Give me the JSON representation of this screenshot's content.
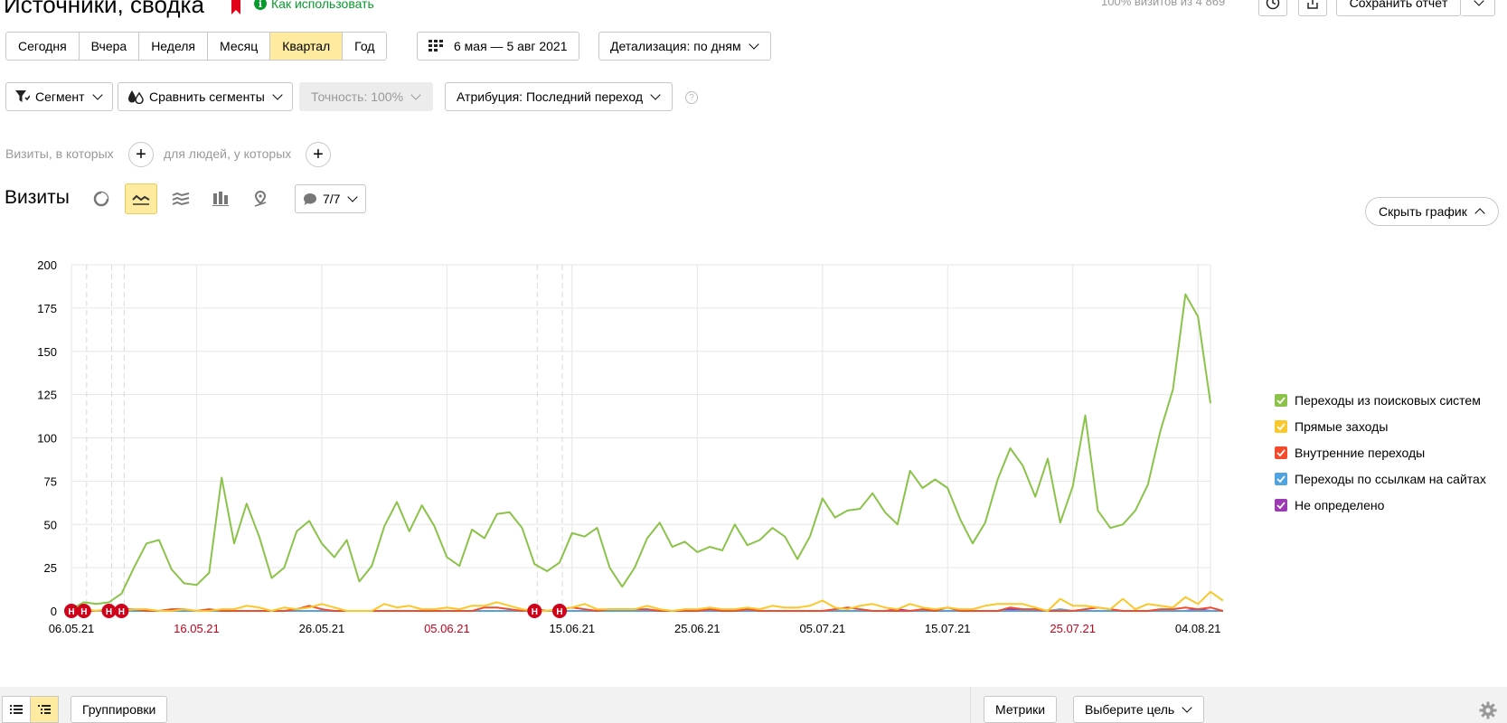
{
  "header": {
    "title": "Источники, сводка",
    "howto_label": "Как использовать",
    "visits_stat": "100% визитов из 4 869",
    "save_label": "Сохранить отчёт"
  },
  "period": {
    "buttons": [
      "Сегодня",
      "Вчера",
      "Неделя",
      "Месяц",
      "Квартал",
      "Год"
    ],
    "active": "Квартал",
    "date_range": "6 мая — 5 авг 2021",
    "detail": "Детализация: по дням"
  },
  "toolbar": {
    "segment": "Сегмент",
    "compare": "Сравнить сегменты",
    "accuracy": "Точность: 100%",
    "attribution": "Атрибуция: Последний переход"
  },
  "filters": {
    "visits_where": "Визиты, в которых",
    "people_where": "для людей, у которых"
  },
  "chart_header": {
    "label": "Визиты",
    "annotations": "7/7",
    "hide_chart": "Скрыть график"
  },
  "bottom": {
    "groupings": "Группировки",
    "metrics": "Метрики",
    "goal": "Выберите цель"
  },
  "chart_data": {
    "type": "line",
    "x_ticks": [
      "06.05.21",
      "16.05.21",
      "26.05.21",
      "05.06.21",
      "15.06.21",
      "25.06.21",
      "05.07.21",
      "15.07.21",
      "25.07.21",
      "04.08.21"
    ],
    "weekend_ticks": [
      "16.05.21",
      "05.06.21",
      "25.07.21"
    ],
    "y_ticks": [
      0,
      25,
      50,
      75,
      100,
      125,
      150,
      175,
      200
    ],
    "ylim": [
      0,
      200
    ],
    "x_range_days": 91,
    "holiday_marker_days": [
      0,
      1,
      3,
      4,
      37,
      39
    ],
    "holiday_marker_label": "Н",
    "grid": true,
    "legend_position": "right",
    "series": [
      {
        "name": "Переходы из поисковых систем",
        "color": "#8bc34a",
        "values": [
          1,
          5,
          4,
          5,
          10,
          25,
          39,
          41,
          24,
          16,
          15,
          22,
          77,
          39,
          62,
          43,
          19,
          25,
          46,
          52,
          39,
          31,
          41,
          17,
          26,
          49,
          63,
          46,
          61,
          49,
          31,
          26,
          47,
          42,
          56,
          57,
          48,
          27,
          23,
          28,
          45,
          43,
          48,
          25,
          14,
          25,
          42,
          51,
          37,
          40,
          34,
          37,
          35,
          50,
          38,
          41,
          48,
          43,
          30,
          43,
          65,
          54,
          58,
          59,
          68,
          57,
          50,
          81,
          71,
          76,
          71,
          53,
          39,
          51,
          76,
          94,
          84,
          66,
          88,
          51,
          72,
          113,
          58,
          48,
          50,
          58,
          73,
          104,
          128,
          183,
          170,
          120
        ]
      },
      {
        "name": "Прямые заходы",
        "color": "#f9c82b",
        "values": [
          0,
          1,
          0,
          1,
          0,
          1,
          1,
          0,
          0,
          1,
          0,
          0,
          1,
          1,
          3,
          2,
          0,
          2,
          1,
          2,
          4,
          2,
          0,
          0,
          0,
          4,
          2,
          3,
          1,
          1,
          2,
          1,
          3,
          3,
          5,
          3,
          1,
          0,
          0,
          1,
          2,
          4,
          1,
          1,
          1,
          1,
          3,
          1,
          0,
          1,
          1,
          2,
          1,
          1,
          2,
          1,
          3,
          2,
          2,
          3,
          6,
          2,
          1,
          3,
          4,
          2,
          1,
          4,
          2,
          1,
          2,
          1,
          1,
          3,
          4,
          4,
          4,
          2,
          0,
          7,
          3,
          3,
          2,
          1,
          7,
          1,
          4,
          3,
          2,
          8,
          4,
          11,
          6
        ]
      },
      {
        "name": "Внутренние переходы",
        "color": "#f54b2a",
        "values": [
          0,
          0,
          0,
          1,
          1,
          1,
          0,
          0,
          1,
          1,
          0,
          1,
          0,
          0,
          0,
          0,
          0,
          0,
          1,
          3,
          1,
          0,
          0,
          0,
          0,
          0,
          0,
          0,
          0,
          0,
          0,
          0,
          0,
          2,
          2,
          1,
          0,
          1,
          0,
          1,
          2,
          1,
          0,
          1,
          1,
          1,
          1,
          0,
          0,
          0,
          0,
          1,
          0,
          0,
          1,
          0,
          0,
          0,
          0,
          0,
          0,
          1,
          2,
          1,
          0,
          0,
          0,
          0,
          1,
          0,
          2,
          0,
          0,
          0,
          0,
          2,
          1,
          1,
          0,
          0,
          0,
          1,
          2,
          1,
          0,
          0,
          0,
          1,
          1,
          2,
          1,
          2,
          0
        ]
      },
      {
        "name": "Переходы по ссылкам на сайтах",
        "color": "#4fa3e0",
        "values": [
          0,
          0,
          0,
          0,
          0,
          0,
          0,
          0,
          0,
          0,
          0,
          0,
          0,
          0,
          0,
          0,
          0,
          0,
          0,
          0,
          0,
          0,
          0,
          0,
          0,
          0,
          0,
          0,
          0,
          0,
          0,
          0,
          0,
          0,
          0,
          0,
          0,
          0,
          0,
          0,
          0,
          0,
          0,
          0,
          0,
          0,
          0,
          0,
          0,
          0,
          0,
          0,
          0,
          0,
          0,
          0,
          0,
          0,
          0,
          0,
          0,
          0,
          0,
          0,
          0,
          0,
          0,
          0,
          0,
          0,
          0,
          0,
          0,
          0,
          0,
          0,
          0,
          0,
          0,
          1,
          0,
          0,
          0,
          0,
          0,
          0,
          0,
          0,
          0,
          0,
          0,
          0,
          0
        ]
      },
      {
        "name": "Не определено",
        "color": "#9c3ab3",
        "values": [
          0,
          0,
          0,
          0,
          0,
          0,
          0,
          0,
          0,
          0,
          0,
          0,
          0,
          0,
          0,
          0,
          0,
          0,
          0,
          0,
          0,
          0,
          0,
          0,
          0,
          0,
          0,
          0,
          0,
          0,
          0,
          0,
          0,
          0,
          0,
          0,
          0,
          0,
          0,
          0,
          0,
          0,
          0,
          0,
          0,
          0,
          0,
          0,
          0,
          0,
          0,
          0,
          0,
          0,
          0,
          0,
          0,
          0,
          0,
          0,
          0,
          0,
          0,
          0,
          0,
          0,
          1,
          0,
          0,
          0,
          0,
          0,
          0,
          0,
          0,
          1,
          0,
          0,
          0,
          0,
          0,
          0,
          0,
          0,
          0,
          0,
          0,
          0,
          0,
          0,
          1,
          0,
          0
        ]
      }
    ]
  }
}
